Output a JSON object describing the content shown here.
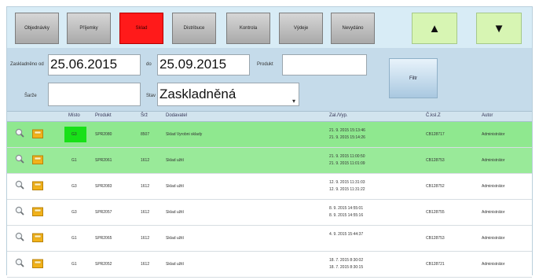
{
  "toolbar": {
    "buttons": [
      {
        "label": "Objednávky",
        "active": false
      },
      {
        "label": "Příjemky",
        "active": false
      },
      {
        "label": "Sklad",
        "active": true
      },
      {
        "label": "Distribuce",
        "active": false
      },
      {
        "label": "Kontrola",
        "active": false
      },
      {
        "label": "Výdeje",
        "active": false
      },
      {
        "label": "Nevydáno",
        "active": false
      }
    ],
    "up_arrow": "▲",
    "down_arrow": "▼",
    "active_color": "#ff1a1a",
    "arrow_color": "#d7f5b3"
  },
  "filter": {
    "date_from_label": "Zaskladněno od",
    "date_from": "25.06.2015",
    "date_to_label": "do",
    "date_to": "25.09.2015",
    "product_label": "Produkt",
    "product_value": "",
    "batch_label": "Šarže",
    "batch_value": "",
    "state_label": "Stav",
    "state_value": "Zaskladněná",
    "find_label": "Filtr"
  },
  "table": {
    "columns": [
      "Místo",
      "Produkt",
      "Šrž",
      "Dodavatel",
      "Zal./Vyp.",
      "Č.ksl.Z",
      "Autor"
    ],
    "rows": [
      {
        "highlight": "green",
        "mn_highlight": true,
        "place": "G3",
        "product": "SPR2080",
        "batch": "8507",
        "supplier": "Sklad Vyrobni sklady",
        "dates": [
          "21. 9. 2015 15:13:46",
          "21. 9. 2015 15:14:26"
        ],
        "doc": "CB128717",
        "author": "Administrátor"
      },
      {
        "highlight": "lightgreen",
        "mn_highlight": false,
        "place": "G1",
        "product": "SPR2061",
        "batch": "1612",
        "supplier": "Sklad užití",
        "dates": [
          "21. 9. 2015 11:00:50",
          "21. 9. 2015 11:01:09"
        ],
        "doc": "CB128753",
        "author": "Administrátor"
      },
      {
        "highlight": "none",
        "mn_highlight": false,
        "place": "G3",
        "product": "SPR2083",
        "batch": "1612",
        "supplier": "Sklad užití",
        "dates": [
          "12. 9. 2015 11:31:03",
          "12. 9. 2015 11:31:22"
        ],
        "doc": "CB128752",
        "author": "Administrátor"
      },
      {
        "highlight": "none",
        "mn_highlight": false,
        "place": "G3",
        "product": "SPR2057",
        "batch": "1612",
        "supplier": "Sklad užití",
        "dates": [
          "8. 9. 2015 14:55:01",
          "8. 9. 2015 14:55:16"
        ],
        "doc": "CB128755",
        "author": "Administrátor"
      },
      {
        "highlight": "none",
        "mn_highlight": false,
        "place": "G1",
        "product": "SPR2065",
        "batch": "1612",
        "supplier": "Sklad užití",
        "dates": [
          "4. 9. 2015 15:44:37",
          ""
        ],
        "doc": "CB128753",
        "author": "Administrátor"
      },
      {
        "highlight": "none",
        "mn_highlight": false,
        "place": "G1",
        "product": "SPR2052",
        "batch": "1612",
        "supplier": "Sklad užití",
        "dates": [
          "18. 7. 2015 8:30:02",
          "18. 7. 2015 8:30:15"
        ],
        "doc": "CB128721",
        "author": "Administrátor"
      }
    ]
  }
}
